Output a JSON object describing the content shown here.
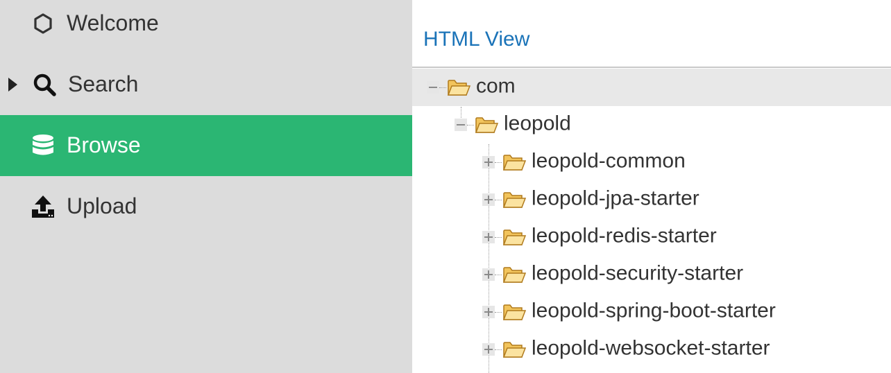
{
  "sidebar": {
    "items": [
      {
        "label": "Welcome",
        "icon": "hexagon-icon",
        "active": false
      },
      {
        "label": "Search",
        "icon": "search-icon",
        "active": false,
        "collapsed_caret": true
      },
      {
        "label": "Browse",
        "icon": "database-icon",
        "active": true
      },
      {
        "label": "Upload",
        "icon": "upload-icon",
        "active": false
      }
    ],
    "active_color": "#2bb673",
    "background": "#dcdcdc"
  },
  "main": {
    "view_title": "HTML View",
    "title_color": "#1a73b8",
    "tree": {
      "nodes": [
        {
          "label": "com",
          "state": "expanded",
          "selected": true
        },
        {
          "label": "leopold",
          "state": "expanded",
          "selected": false
        },
        {
          "label": "leopold-common",
          "state": "collapsed",
          "selected": false
        },
        {
          "label": "leopold-jpa-starter",
          "state": "collapsed",
          "selected": false
        },
        {
          "label": "leopold-redis-starter",
          "state": "collapsed",
          "selected": false
        },
        {
          "label": "leopold-security-starter",
          "state": "collapsed",
          "selected": false
        },
        {
          "label": "leopold-spring-boot-starter",
          "state": "collapsed",
          "selected": false
        },
        {
          "label": "leopold-websocket-starter",
          "state": "collapsed",
          "selected": false
        }
      ]
    }
  }
}
